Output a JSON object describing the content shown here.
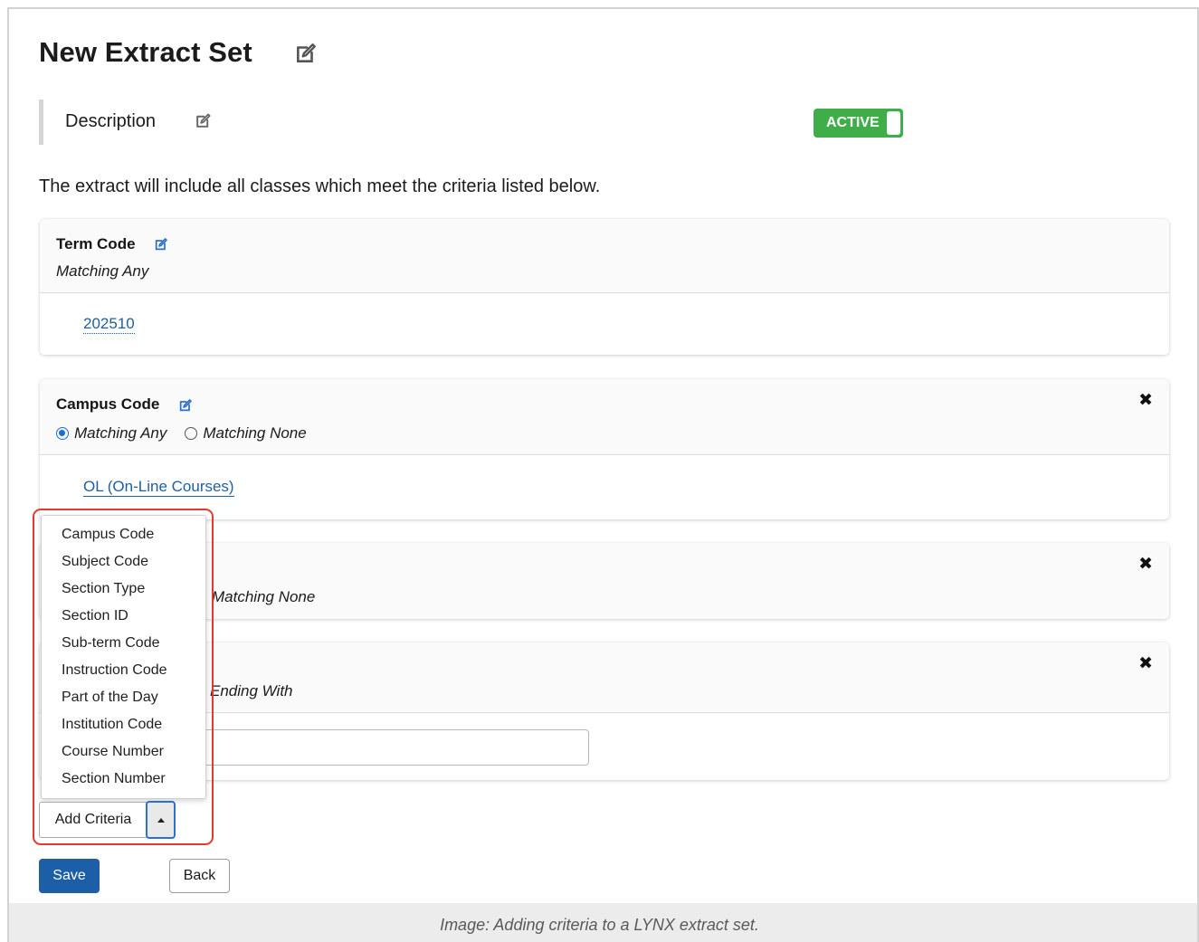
{
  "page": {
    "title": "New Extract Set",
    "description_label": "Description",
    "status_toggle": "ACTIVE",
    "intro_text": "The extract will include all classes which meet the criteria listed below."
  },
  "criteria": [
    {
      "title": "Term Code",
      "match_text": "Matching Any",
      "value": "202510"
    },
    {
      "title": "Campus Code",
      "options": [
        "Matching Any",
        "Matching None"
      ],
      "selected": "Matching Any",
      "value": "OL (On-Line Courses)",
      "remove_icon": "close-icon"
    },
    {
      "partial_match_text": "Matching None",
      "remove_icon": "close-icon"
    },
    {
      "partial_match_text": "Ending With",
      "remove_icon": "close-icon",
      "input_value": ""
    }
  ],
  "add_criteria": {
    "label": "Add Criteria",
    "menu_items": [
      "Campus Code",
      "Subject Code",
      "Section Type",
      "Section ID",
      "Sub-term Code",
      "Instruction Code",
      "Part of the Day",
      "Institution Code",
      "Course Number",
      "Section Number"
    ]
  },
  "actions": {
    "save": "Save",
    "back": "Back"
  },
  "caption": "Image: Adding criteria to a LYNX extract set.",
  "colors": {
    "active_green": "#3fae49",
    "primary_blue": "#1d5fa6",
    "link_blue": "#1f5f9c",
    "highlight_red": "#e23a2e"
  }
}
